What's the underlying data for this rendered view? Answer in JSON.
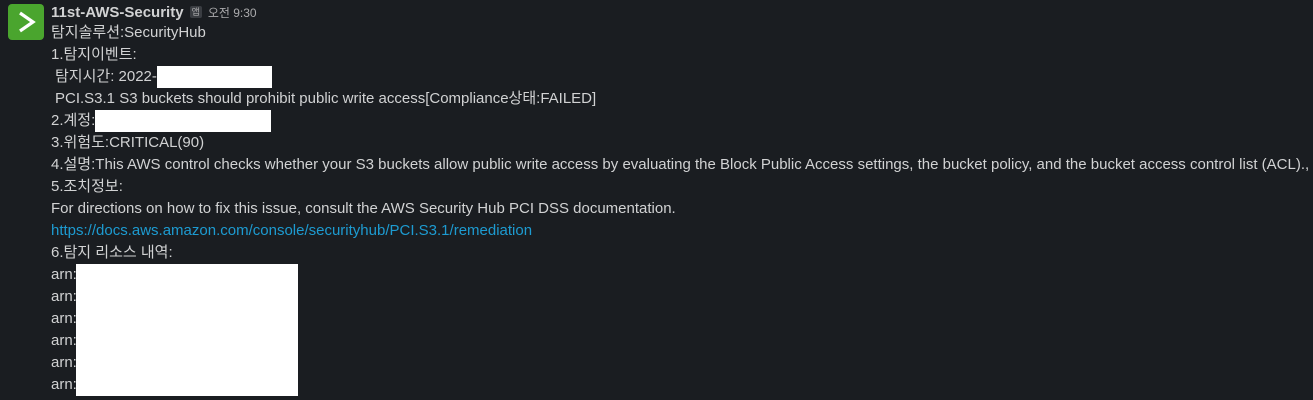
{
  "message": {
    "sender": "11st-AWS-Security",
    "app_badge": "앱",
    "time": "오전 9:30",
    "avatar_icon": "chevron-right-icon",
    "avatar_color": "#4aa52e",
    "lines": {
      "solution": "탐지솔루션:SecurityHub",
      "event_header": "1.탐지이벤트:",
      "detect_time": "탐지시간: 2022-",
      "finding": "PCI.S3.1 S3 buckets should prohibit public write access[Compliance상태:FAILED]",
      "account": "2.계정:",
      "severity": "3.위험도:CRITICAL(90)",
      "description": "4.설명:This AWS control checks whether your S3 buckets allow public write access by evaluating the Block Public Access settings, the bucket policy, and the bucket access control list (ACL).,",
      "remediation_header": "5.조치정보:",
      "remediation_text": "For directions on how to fix this issue, consult the AWS Security Hub PCI DSS documentation.",
      "remediation_link": "https://docs.aws.amazon.com/console/securityhub/PCI.S3.1/remediation",
      "resources_header": "6.탐지 리소스 내역:"
    },
    "resources": [
      "arn:aws:s3:",
      "arn:aws:s3:",
      "arn:aws:s3:",
      "arn:aws:s3:",
      "arn:aws:s3:",
      "arn:aws:s3:"
    ],
    "link_color": "#1d9bd1"
  }
}
